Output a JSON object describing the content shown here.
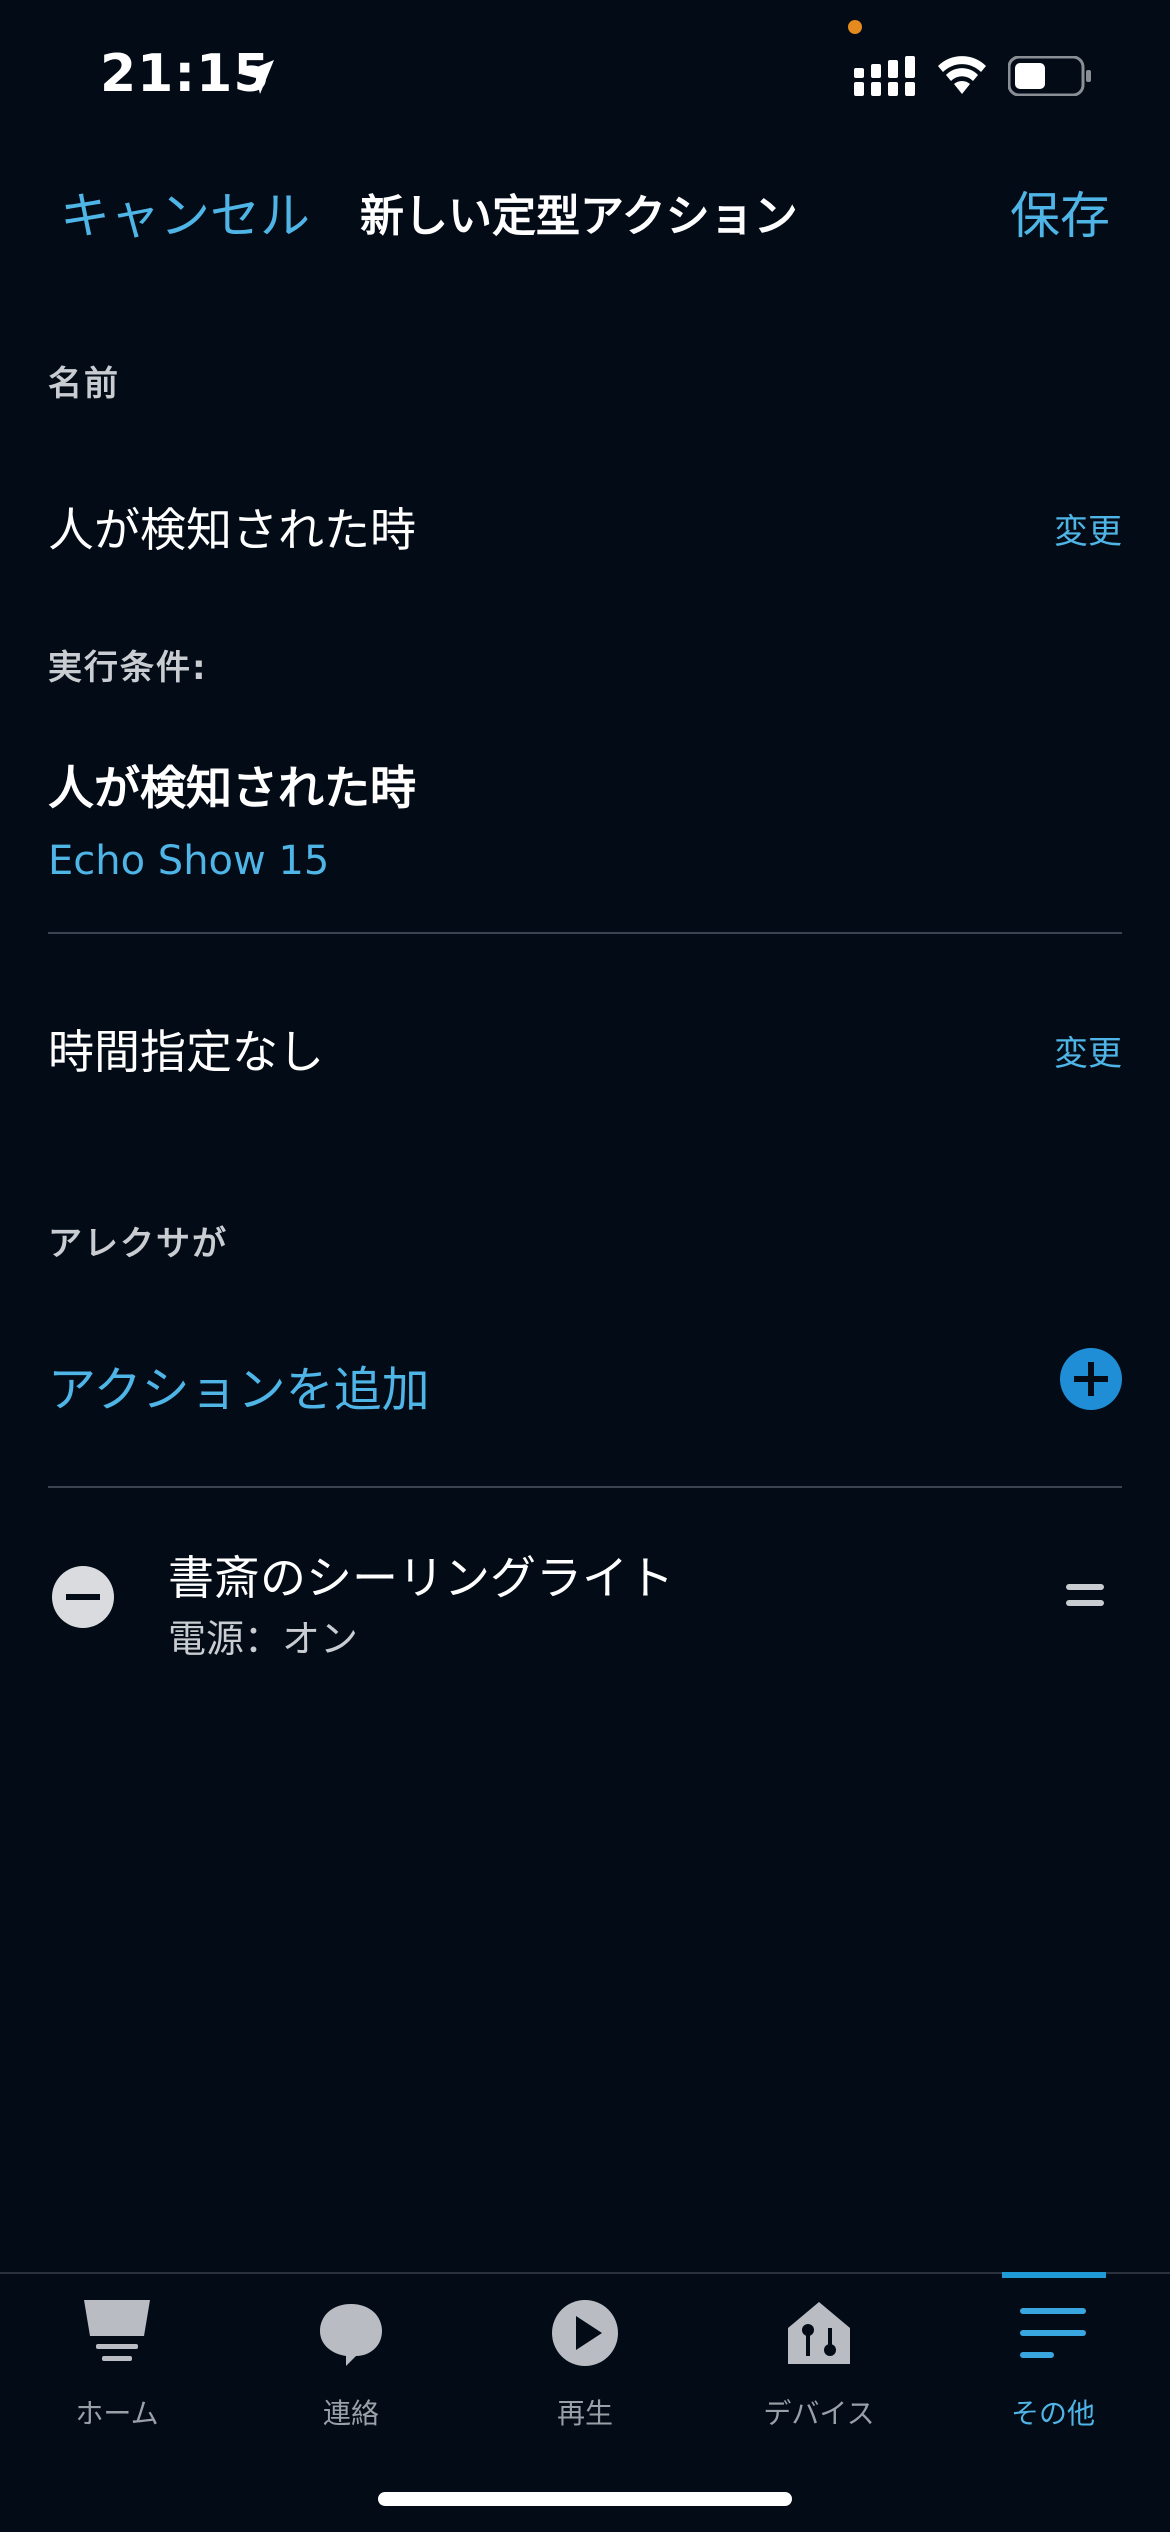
{
  "status_bar": {
    "time": "21:15"
  },
  "nav": {
    "cancel_label": "キャンセル",
    "title": "新しい定型アクション",
    "save_label": "保存"
  },
  "name_section": {
    "label": "名前",
    "value": "人が検知された時",
    "change_label": "変更"
  },
  "trigger_section": {
    "label": "実行条件:",
    "title": "人が検知された時",
    "device": "Echo Show 15"
  },
  "schedule": {
    "value": "時間指定なし",
    "change_label": "変更"
  },
  "alexa_section": {
    "label": "アレクサが",
    "add_action_label": "アクションを追加",
    "actions": [
      {
        "name": "書斎のシーリングライト",
        "detail": "電源：オン"
      }
    ]
  },
  "tabbar": {
    "tabs": [
      {
        "label": "ホーム",
        "icon": "home-icon",
        "active": false
      },
      {
        "label": "連絡",
        "icon": "chat-bubble-icon",
        "active": false
      },
      {
        "label": "再生",
        "icon": "play-icon",
        "active": false
      },
      {
        "label": "デバイス",
        "icon": "devices-icon",
        "active": false
      },
      {
        "label": "その他",
        "icon": "menu-icon",
        "active": true
      }
    ]
  },
  "colors": {
    "background": "#020b16",
    "accent": "#4fb4e6",
    "accent_button": "#1f8ed6"
  }
}
